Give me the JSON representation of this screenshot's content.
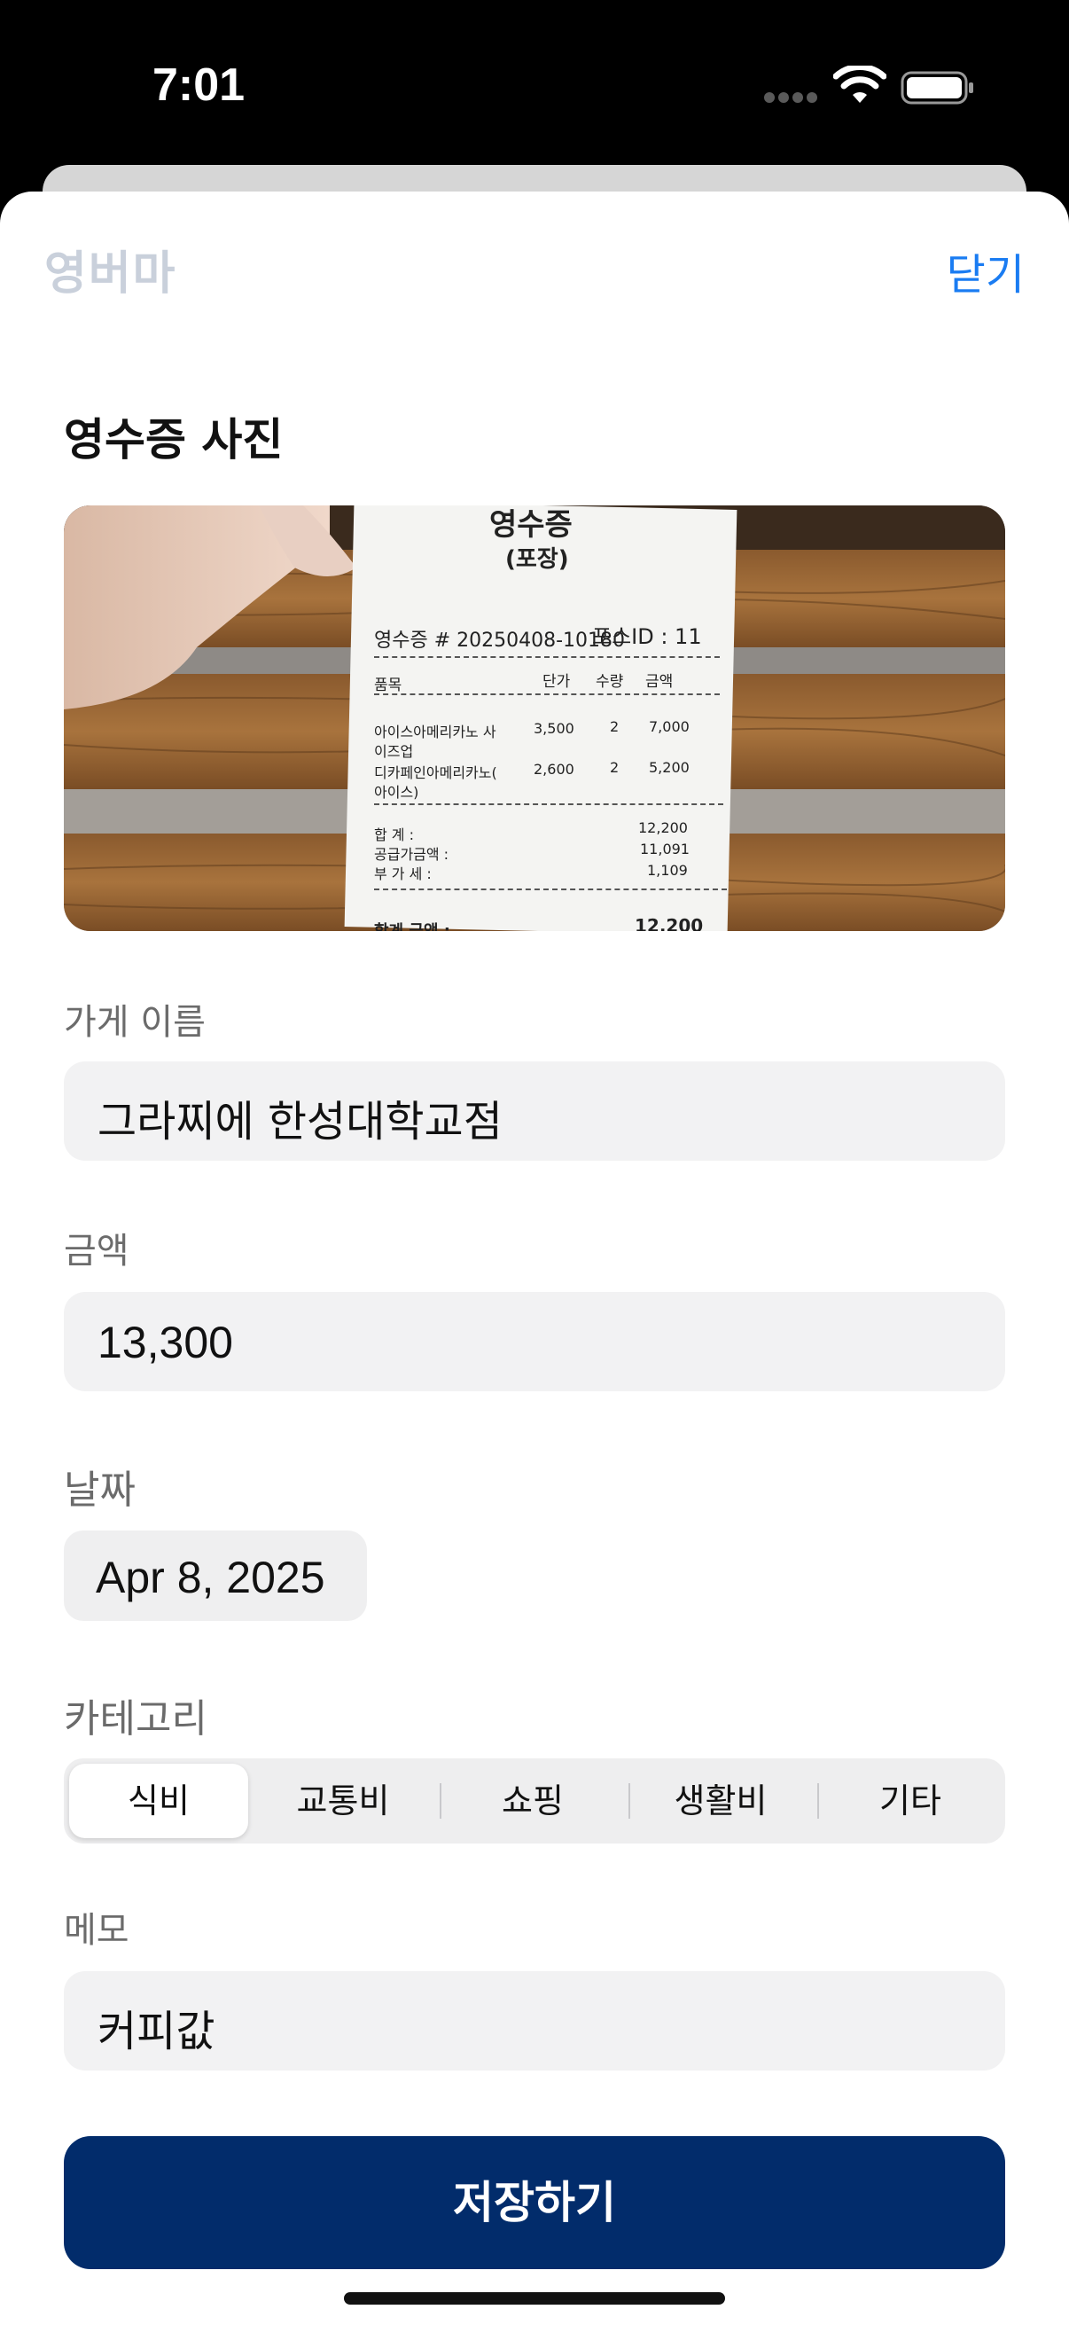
{
  "status_bar": {
    "time": "7:01"
  },
  "header": {
    "logo_text": "영버마",
    "close_label": "닫기"
  },
  "photo_section": {
    "title": "영수증 사진"
  },
  "receipt": {
    "title": "영수증",
    "subtitle": "(포장)",
    "number": "영수증 # 20250408-10180",
    "pos": "포스ID : 11",
    "headers": [
      "품목",
      "단가",
      "수량",
      "금액"
    ],
    "items": [
      {
        "name1": "아이스아메리카노 사",
        "name2": "이즈업",
        "price": "3,500",
        "qty": "2",
        "amount": "7,000"
      },
      {
        "name1": "디카페인아메리카노(",
        "name2": "아이스)",
        "price": "2,600",
        "qty": "2",
        "amount": "5,200"
      }
    ],
    "totals": [
      {
        "label": "합 계 :",
        "value": "12,200"
      },
      {
        "label": "공급가금액 :",
        "value": "11,091"
      },
      {
        "label": "부 가 세 :",
        "value": "1,109"
      }
    ],
    "final_label": "합계 금액 :",
    "final_value": "12,200"
  },
  "store": {
    "label": "가게 이름",
    "value": "그라찌에 한성대학교점"
  },
  "amount": {
    "label": "금액",
    "value": "13,300"
  },
  "date": {
    "label": "날짜",
    "value": "Apr 8, 2025"
  },
  "category": {
    "label": "카테고리",
    "options": [
      "식비",
      "교통비",
      "쇼핑",
      "생활비",
      "기타"
    ],
    "selected": "식비"
  },
  "memo": {
    "label": "메모",
    "value": "커피값"
  },
  "save_label": "저장하기",
  "colors": {
    "accent": "#1a7cf2",
    "primary_button": "#022c6b",
    "field_bg": "#f2f2f3"
  }
}
